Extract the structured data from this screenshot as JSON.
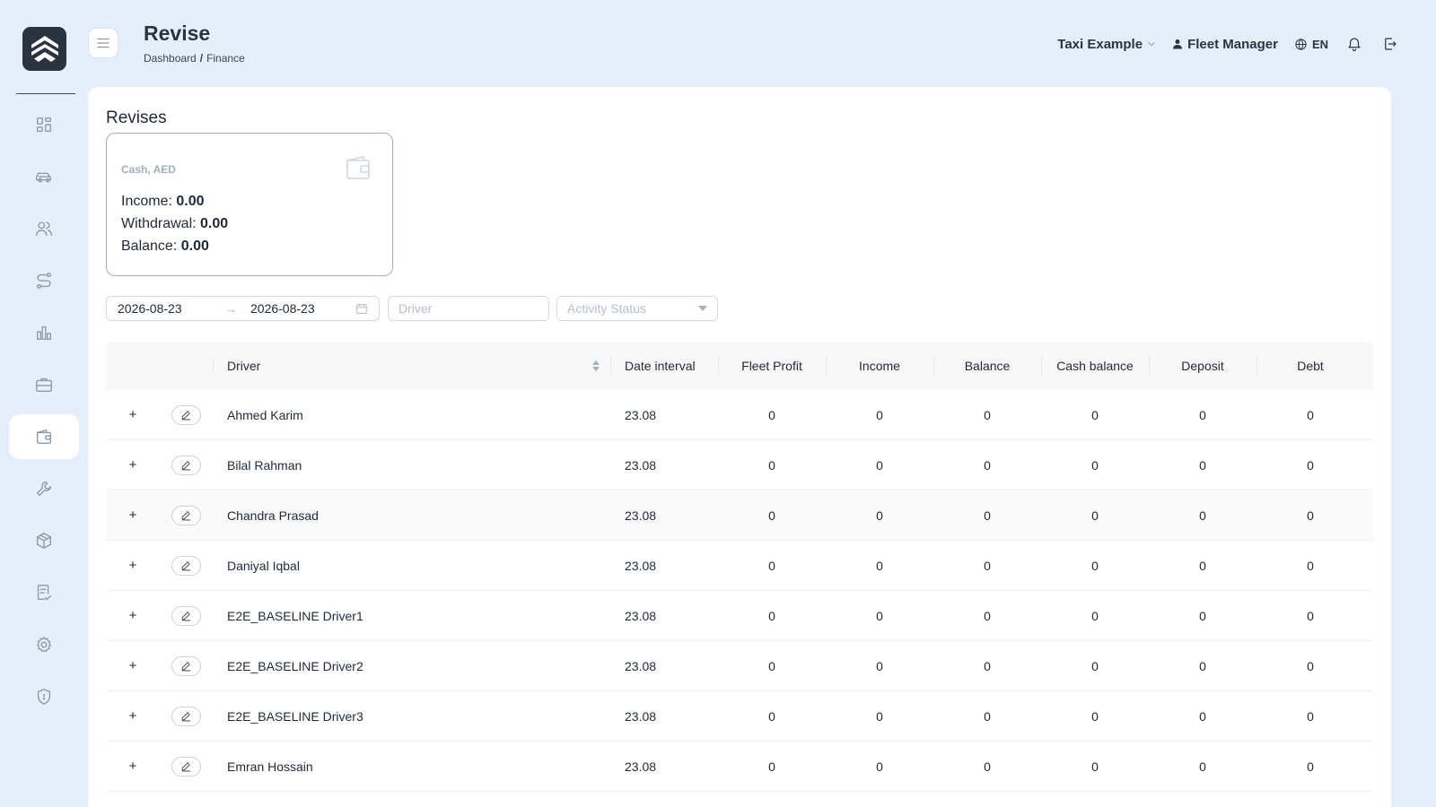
{
  "header": {
    "title": "Revise",
    "breadcrumb": [
      "Dashboard",
      "Finance"
    ],
    "breadcrumb_sep": "/",
    "company": "Taxi Example",
    "user_role": "Fleet Manager",
    "language": "EN"
  },
  "sidebar": {
    "items": [
      {
        "name": "dashboard",
        "icon": "grid-icon"
      },
      {
        "name": "vehicles",
        "icon": "car-icon"
      },
      {
        "name": "drivers",
        "icon": "users-icon"
      },
      {
        "name": "routes",
        "icon": "route-icon"
      },
      {
        "name": "reports",
        "icon": "bar-chart-icon"
      },
      {
        "name": "business",
        "icon": "briefcase-icon"
      },
      {
        "name": "finance",
        "icon": "wallet-icon",
        "active": true
      },
      {
        "name": "maintenance",
        "icon": "wrench-icon"
      },
      {
        "name": "inventory",
        "icon": "box-icon"
      },
      {
        "name": "documents",
        "icon": "document-check-icon"
      },
      {
        "name": "settings",
        "icon": "gear-icon"
      },
      {
        "name": "security",
        "icon": "shield-icon"
      }
    ]
  },
  "section": {
    "title": "Revises"
  },
  "summary": {
    "label": "Cash, AED",
    "income_label": "Income:",
    "income_value": "0.00",
    "withdrawal_label": "Withdrawal:",
    "withdrawal_value": "0.00",
    "balance_label": "Balance:",
    "balance_value": "0.00"
  },
  "filters": {
    "date_from": "2026-08-23",
    "date_to": "2026-08-23",
    "driver_placeholder": "Driver",
    "status_placeholder": "Activity Status"
  },
  "table": {
    "columns": [
      "Driver",
      "Date interval",
      "Fleet Profit",
      "Income",
      "Balance",
      "Cash balance",
      "Deposit",
      "Debt"
    ],
    "rows": [
      {
        "driver": "Ahmed Karim",
        "date": "23.08",
        "fleet_profit": "0",
        "income": "0",
        "balance": "0",
        "cash_balance": "0",
        "deposit": "0",
        "debt": "0"
      },
      {
        "driver": "Bilal Rahman",
        "date": "23.08",
        "fleet_profit": "0",
        "income": "0",
        "balance": "0",
        "cash_balance": "0",
        "deposit": "0",
        "debt": "0"
      },
      {
        "driver": "Chandra Prasad",
        "date": "23.08",
        "fleet_profit": "0",
        "income": "0",
        "balance": "0",
        "cash_balance": "0",
        "deposit": "0",
        "debt": "0"
      },
      {
        "driver": "Daniyal Iqbal",
        "date": "23.08",
        "fleet_profit": "0",
        "income": "0",
        "balance": "0",
        "cash_balance": "0",
        "deposit": "0",
        "debt": "0"
      },
      {
        "driver": "E2E_BASELINE Driver1",
        "date": "23.08",
        "fleet_profit": "0",
        "income": "0",
        "balance": "0",
        "cash_balance": "0",
        "deposit": "0",
        "debt": "0"
      },
      {
        "driver": "E2E_BASELINE Driver2",
        "date": "23.08",
        "fleet_profit": "0",
        "income": "0",
        "balance": "0",
        "cash_balance": "0",
        "deposit": "0",
        "debt": "0"
      },
      {
        "driver": "E2E_BASELINE Driver3",
        "date": "23.08",
        "fleet_profit": "0",
        "income": "0",
        "balance": "0",
        "cash_balance": "0",
        "deposit": "0",
        "debt": "0"
      },
      {
        "driver": "Emran Hossain",
        "date": "23.08",
        "fleet_profit": "0",
        "income": "0",
        "balance": "0",
        "cash_balance": "0",
        "deposit": "0",
        "debt": "0"
      }
    ],
    "expand_symbol": "+"
  }
}
